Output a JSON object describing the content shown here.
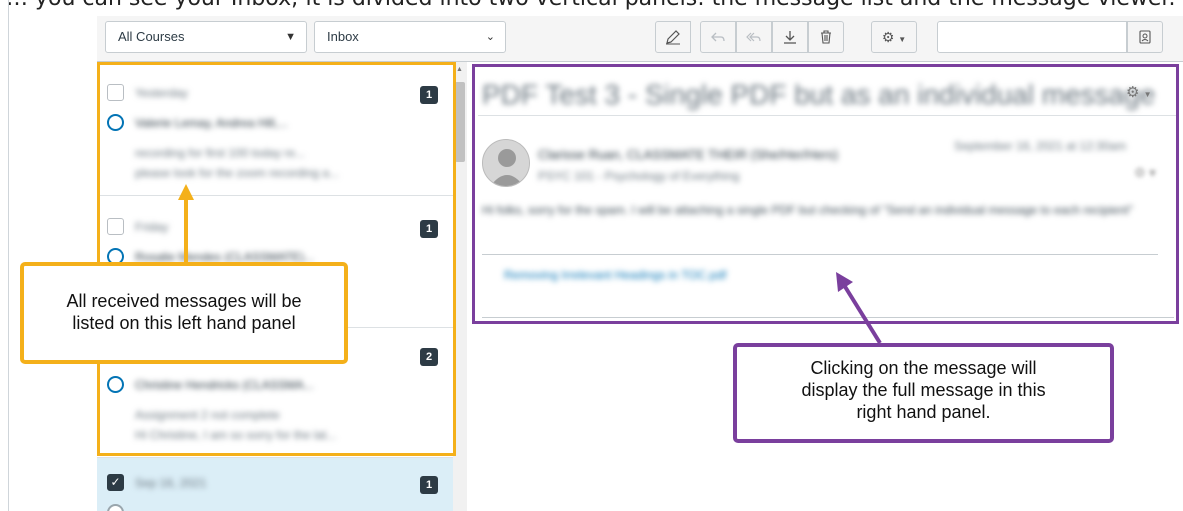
{
  "caption": {
    "text": "… you can see your Inbox; it is divided into two vertical panels: the message list and the message viewer."
  },
  "toolbar": {
    "course_filter": "All Courses",
    "mailbox_filter": "Inbox",
    "search_placeholder": "",
    "icons": [
      "compose-icon",
      "reply-icon",
      "reply-all-icon",
      "archive-icon",
      "delete-icon",
      "settings-icon",
      "address-book-icon"
    ]
  },
  "messages": [
    {
      "date": "Yesterday",
      "participants": "Valerie Lemay, Andrea Hill,...",
      "subject": "recording for first 100 today re...",
      "preview": "please look for the zoom recording a...",
      "count": "1",
      "unread": true,
      "checked": false
    },
    {
      "date": "Friday",
      "participants": "Rosalie Mendes (CLASSMATE)...",
      "subject": "",
      "preview": "",
      "count": "1",
      "unread": true,
      "checked": false
    },
    {
      "date": "",
      "participants": "Christine Hendricks (CLASSMA...",
      "subject": "Assignment 2 not complete",
      "preview": "Hi Christine, I am so sorry for the lat...",
      "count": "2",
      "unread": true,
      "checked": false
    },
    {
      "date": "Sep 16, 2021",
      "participants": "",
      "subject": "",
      "preview": "",
      "count": "1",
      "unread": false,
      "checked": true
    }
  ],
  "viewer": {
    "subject": "PDF Test 3 - Single PDF but as an individual message",
    "sender": "Clarisse Ruan, CLASSMATE THEIR (She/Her/Hers)",
    "course": "PSYC 101 - Psychology of Everything",
    "date": "September 16, 2021 at 12:30am",
    "body": "Hi folks, sorry for the spam. I will be attaching a single PDF but checking of \"Send an individual message to each recipient\"",
    "attachment": "Removing Irrelevant Headings in TOC.pdf"
  },
  "annotations": {
    "left_lines": [
      "All received messages will be",
      "listed on this left hand panel"
    ],
    "right_lines": [
      "Clicking on the message will",
      "display the full message in this",
      "right hand panel."
    ]
  },
  "colors": {
    "orange": "#f4b01a",
    "purple": "#7a3f9d",
    "badge": "#2d3b45",
    "unread_ring": "#0374b5",
    "selected_row": "#dbeef7"
  }
}
